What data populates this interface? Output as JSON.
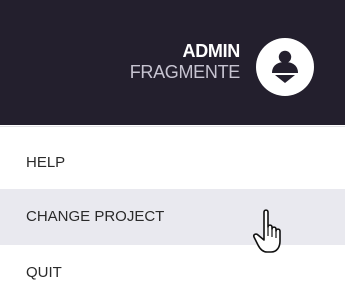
{
  "header": {
    "user_name": "ADMIN",
    "user_org": "FRAGMENTE",
    "avatar_icon": "user-icon"
  },
  "menu": {
    "items": [
      {
        "label": "HELP",
        "state": "normal"
      },
      {
        "label": "CHANGE PROJECT",
        "state": "hover"
      },
      {
        "label": "QUIT",
        "state": "normal"
      }
    ]
  },
  "cursor": {
    "icon": "hand-pointer-icon"
  },
  "colors": {
    "header_bg": "#231f2d",
    "hover_bg": "#e9e9ef",
    "text": "#2a2a2a"
  }
}
